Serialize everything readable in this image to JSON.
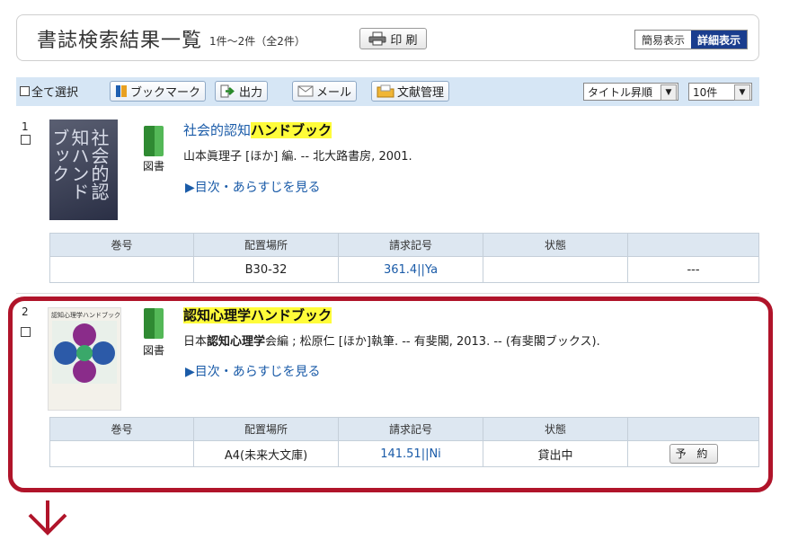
{
  "header": {
    "title": "書誌検索結果一覧",
    "count": "1件～2件（全2件）",
    "print_label": "印 刷",
    "view_simple": "簡易表示",
    "view_detail": "詳細表示"
  },
  "toolbar": {
    "select_all": "全て選択",
    "bookmark": "ブックマーク",
    "output": "出力",
    "mail": "メール",
    "library": "文献管理",
    "sort_value": "タイトル昇順",
    "perpage_value": "10件"
  },
  "results": [
    {
      "number": "1",
      "type": "図書",
      "title_pre": "社会的認知",
      "title_hl": "ハンドブック",
      "meta": "山本眞理子 [ほか] 編. -- 北大路書房, 2001.",
      "toc": "▶目次・あらすじを見る",
      "cover_text": "社会的認知ハンドブック",
      "holdings_headers": [
        "巻号",
        "配置場所",
        "請求記号",
        "状態",
        ""
      ],
      "holdings": [
        "",
        "B30-32",
        "361.4||Ya",
        "",
        "---"
      ]
    },
    {
      "number": "2",
      "type": "図書",
      "title_hl": "認知心理学ハンドブック",
      "meta_pre": "日本",
      "meta_bold": "認知心理学",
      "meta_post": "会編 ; 松原仁 [ほか]執筆. -- 有斐閣, 2013. -- (有斐閣ブックス).",
      "toc": "▶目次・あらすじを見る",
      "cover_text": "認知心理学ハンドブック",
      "holdings_headers": [
        "巻号",
        "配置場所",
        "請求記号",
        "状態",
        ""
      ],
      "holdings": [
        "",
        "A4(未来大文庫)",
        "141.51||Ni",
        "貸出中"
      ],
      "reserve_label": "予 約"
    }
  ],
  "colors": {
    "accent": "#1a3d8e",
    "highlight_frame": "#b0142a",
    "keyword_highlight": "#fffc3a"
  }
}
